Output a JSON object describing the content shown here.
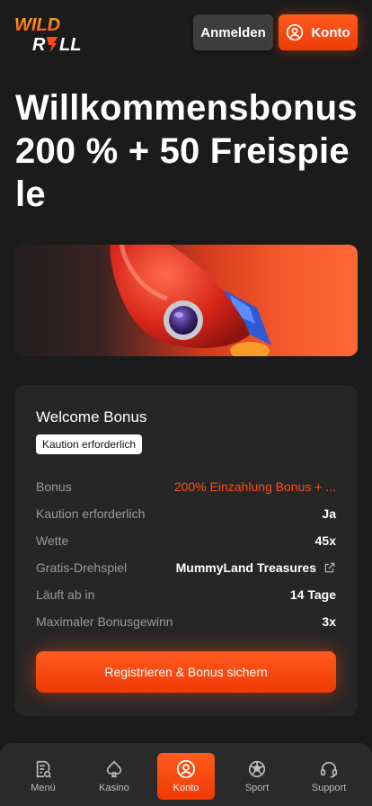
{
  "header": {
    "logo_line1": "WILD",
    "logo_line2": "ROLL",
    "login_label": "Anmelden",
    "account_label": "Konto"
  },
  "hero": {
    "title": "Willkommensbonus 200 % + 50 Freispiele"
  },
  "card": {
    "title": "Welcome Bonus",
    "badge": "Kaution erforderlich",
    "rows": [
      {
        "label": "Bonus",
        "value": "200% Einzahlung Bonus + ..."
      },
      {
        "label": "Kaution erforderlich",
        "value": "Ja"
      },
      {
        "label": "Wette",
        "value": "45x"
      },
      {
        "label": "Gratis-Drehspiel",
        "value": "MummyLand Treasures"
      },
      {
        "label": "Läuft ab in",
        "value": "14 Tage"
      },
      {
        "label": "Maximaler Bonusgewinn",
        "value": "3x"
      }
    ],
    "cta_label": "Registrieren & Bonus sichern"
  },
  "bottom_nav": {
    "items": [
      {
        "label": "Menü",
        "icon": "menu-document-icon"
      },
      {
        "label": "Kasino",
        "icon": "spade-icon"
      },
      {
        "label": "Konto",
        "icon": "user-circle-icon",
        "active": true
      },
      {
        "label": "Sport",
        "icon": "soccer-ball-icon"
      },
      {
        "label": "Support",
        "icon": "headset-icon"
      }
    ]
  },
  "colors": {
    "accent": "#ff4d1a",
    "background": "#1b1b1b",
    "card": "#262626"
  }
}
